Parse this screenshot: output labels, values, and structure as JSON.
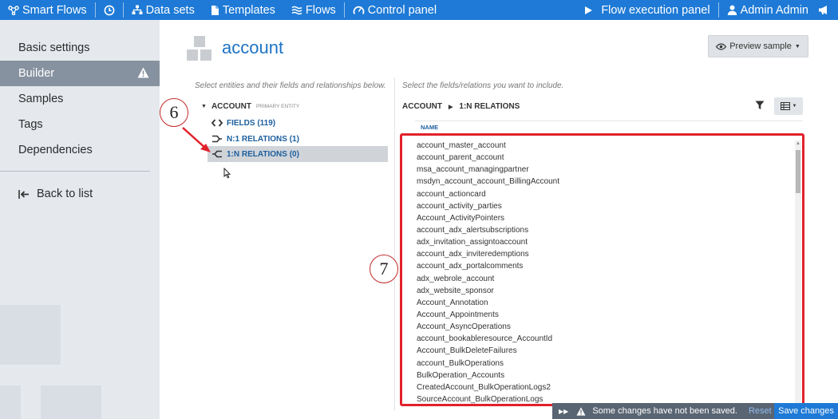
{
  "topbar": {
    "brand": "Smart Flows",
    "datasets": "Data sets",
    "templates": "Templates",
    "flows": "Flows",
    "control_panel": "Control panel",
    "flow_execution": "Flow execution panel",
    "user": "Admin Admin"
  },
  "sidebar": {
    "items": [
      "Basic settings",
      "Builder",
      "Samples",
      "Tags",
      "Dependencies"
    ],
    "active": "Builder",
    "back": "Back to list"
  },
  "page": {
    "title": "account",
    "preview_label": "Preview sample"
  },
  "left_panel": {
    "hint": "Select entities and their fields and relationships below.",
    "root_label": "ACCOUNT",
    "root_badge": "PRIMARY ENTITY",
    "items": [
      "FIELDS (119)",
      "N:1 RELATIONS (1)",
      "1:N RELATIONS (0)"
    ],
    "selected": "1:N RELATIONS (0)"
  },
  "right_panel": {
    "hint": "Select the fields/relations you want to include.",
    "crumb_entity": "ACCOUNT",
    "crumb_section": "1:N RELATIONS",
    "column_header": "NAME",
    "relations": [
      "account_master_account",
      "account_parent_account",
      "msa_account_managingpartner",
      "msdyn_account_account_BillingAccount",
      "account_actioncard",
      "account_activity_parties",
      "Account_ActivityPointers",
      "account_adx_alertsubscriptions",
      "adx_invitation_assigntoaccount",
      "account_adx_inviteredemptions",
      "account_adx_portalcomments",
      "adx_webrole_account",
      "adx_website_sponsor",
      "Account_Annotation",
      "Account_Appointments",
      "Account_AsyncOperations",
      "account_bookableresource_AccountId",
      "Account_BulkDeleteFailures",
      "account_BulkOperations",
      "BulkOperation_Accounts",
      "CreatedAccount_BulkOperationLogs2",
      "SourceAccount_BulkOperationLogs"
    ]
  },
  "annotations": {
    "callout_a": "6",
    "callout_b": "7"
  },
  "save_bar": {
    "message": "Some changes have not been saved.",
    "reset": "Reset",
    "save": "Save changes"
  },
  "colors": {
    "topbar": "#1e7ad6",
    "sidebar_active": "#8792a0",
    "link": "#1c5f9e",
    "highlight_box": "#e2212b"
  }
}
